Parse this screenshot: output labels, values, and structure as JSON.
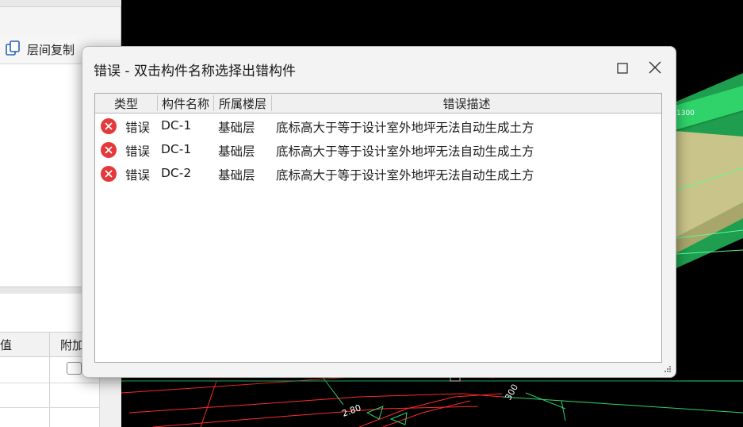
{
  "left_panel": {
    "toolbar_button_label": "层间复制",
    "properties_columns": [
      "值",
      "附加"
    ]
  },
  "dialog": {
    "title": "错误 - 双击构件名称选择出错构件",
    "columns": [
      "类型",
      "构件名称",
      "所属楼层",
      "错误描述"
    ],
    "rows": [
      {
        "type": "错误",
        "name": "DC-1",
        "floor": "基础层",
        "description": "底标高大于等于设计室外地坪无法自动生成土方"
      },
      {
        "type": "错误",
        "name": "DC-1",
        "floor": "基础层",
        "description": "底标高大于等于设计室外地坪无法自动生成土方"
      },
      {
        "type": "错误",
        "name": "DC-2",
        "floor": "基础层",
        "description": "底标高大于等于设计室外地坪无法自动生成土方"
      }
    ]
  },
  "viewport": {
    "labels": [
      "2.80",
      "300"
    ]
  },
  "colors": {
    "error_red": "#e5383b",
    "cad_green": "#2fd36a",
    "cad_red": "#ff2b2b",
    "slab_tan": "#c9c58a"
  },
  "icons": [
    "copy-icon",
    "error-icon",
    "maximize-icon",
    "close-icon",
    "resize-grip-icon"
  ]
}
